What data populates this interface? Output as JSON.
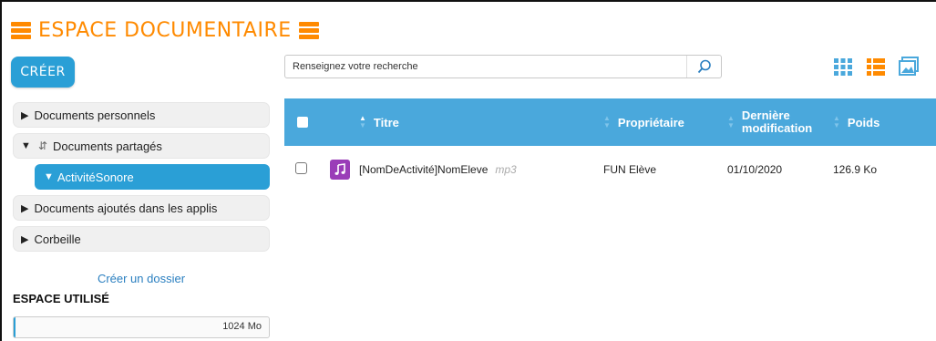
{
  "header": {
    "title": "ESPACE DOCUMENTAIRE"
  },
  "toolbar": {
    "create_label": "CRÉER"
  },
  "search": {
    "placeholder": "Renseignez votre recherche",
    "value": ""
  },
  "sidebar": {
    "items": [
      {
        "label": "Documents personnels",
        "expanded": false
      },
      {
        "label": "Documents partagés",
        "expanded": true,
        "children": [
          {
            "label": "ActivitéSonore",
            "selected": true
          }
        ]
      },
      {
        "label": "Documents ajoutés dans les applis",
        "expanded": false
      },
      {
        "label": "Corbeille",
        "expanded": false
      }
    ],
    "new_folder_label": "Créer un dossier",
    "space_used_label": "ESPACE UTILISÉ",
    "space_amount": "1024 Mo",
    "space_used_fraction": 0.005
  },
  "table": {
    "columns": [
      {
        "key": "titre",
        "label": "Titre"
      },
      {
        "key": "proprietaire",
        "label": "Propriétaire"
      },
      {
        "key": "modification",
        "label": "Dernière modification"
      },
      {
        "key": "poids",
        "label": "Poids"
      }
    ],
    "rows": [
      {
        "title": "[NomDeActivité]NomEleve",
        "ext": "mp3",
        "owner": "FUN Elève",
        "modified": "01/10/2020",
        "size": "126.9 Ko"
      }
    ]
  },
  "colors": {
    "accent": "#2a9fd6",
    "header": "#4aa8dc",
    "brand": "#ff8a00",
    "music": "#9a3db8"
  },
  "icons": {
    "title": "folder-icon",
    "search": "search-icon",
    "views": [
      "grid-view-icon",
      "list-view-icon",
      "carousel-view-icon"
    ],
    "file": "music-note-icon"
  }
}
